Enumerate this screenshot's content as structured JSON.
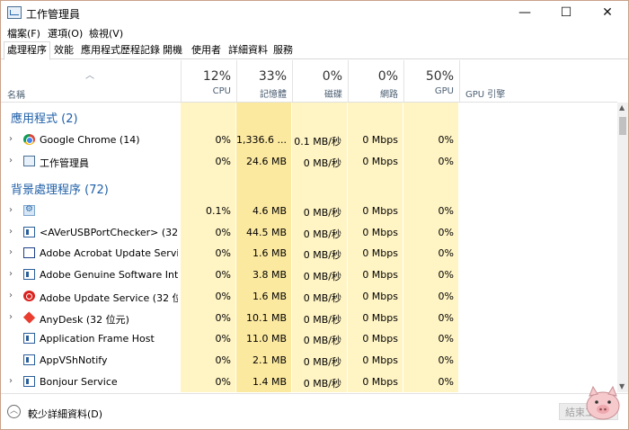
{
  "window": {
    "title": "工作管理員",
    "minimize": "—",
    "maximize": "☐",
    "close": "✕"
  },
  "menu": [
    "檔案(F)",
    "選項(O)",
    "檢視(V)"
  ],
  "tabs": [
    "處理程序",
    "效能",
    "應用程式歷程記錄",
    "開機",
    "使用者",
    "詳細資料",
    "服務"
  ],
  "active_tab": "處理程序",
  "columns": {
    "name": "名稱",
    "cpu": {
      "pct": "12%",
      "label": "CPU"
    },
    "memory": {
      "pct": "33%",
      "label": "記憶體"
    },
    "disk": {
      "pct": "0%",
      "label": "磁碟"
    },
    "network": {
      "pct": "0%",
      "label": "網路"
    },
    "gpu": {
      "pct": "50%",
      "label": "GPU"
    },
    "gpu_engine": {
      "label": "GPU 引擎"
    }
  },
  "groups": {
    "apps": "應用程式 (2)",
    "background": "背景處理程序 (72)"
  },
  "apps": [
    {
      "name": "Google Chrome (14)",
      "icon": "chrome-icon",
      "cpu": "0%",
      "mem": "1,336.6 ...",
      "disk": "0.1 MB/秒",
      "net": "0 Mbps",
      "gpu": "0%"
    },
    {
      "name": "工作管理員",
      "icon": "task-manager-icon",
      "cpu": "0%",
      "mem": "24.6 MB",
      "disk": "0 MB/秒",
      "net": "0 Mbps",
      "gpu": "0%"
    }
  ],
  "background": [
    {
      "name": "",
      "icon": "gear-icon",
      "chev": true,
      "cpu": "0.1%",
      "mem": "4.6 MB",
      "disk": "0 MB/秒",
      "net": "0 Mbps",
      "gpu": "0%"
    },
    {
      "name": "<AVerUSBPortChecker> (32 ...",
      "icon": "window-icon",
      "chev": true,
      "cpu": "0%",
      "mem": "44.5 MB",
      "disk": "0 MB/秒",
      "net": "0 Mbps",
      "gpu": "0%"
    },
    {
      "name": "Adobe Acrobat Update Servi...",
      "icon": "frame-icon",
      "chev": true,
      "cpu": "0%",
      "mem": "1.6 MB",
      "disk": "0 MB/秒",
      "net": "0 Mbps",
      "gpu": "0%"
    },
    {
      "name": "Adobe Genuine Software Inte...",
      "icon": "window-icon",
      "chev": true,
      "cpu": "0%",
      "mem": "3.8 MB",
      "disk": "0 MB/秒",
      "net": "0 Mbps",
      "gpu": "0%"
    },
    {
      "name": "Adobe Update Service (32 位...",
      "icon": "adobe-icon",
      "chev": true,
      "cpu": "0%",
      "mem": "1.6 MB",
      "disk": "0 MB/秒",
      "net": "0 Mbps",
      "gpu": "0%"
    },
    {
      "name": "AnyDesk (32 位元)",
      "icon": "anydesk-icon",
      "chev": true,
      "cpu": "0%",
      "mem": "10.1 MB",
      "disk": "0 MB/秒",
      "net": "0 Mbps",
      "gpu": "0%"
    },
    {
      "name": "Application Frame Host",
      "icon": "window-icon",
      "chev": false,
      "cpu": "0%",
      "mem": "11.0 MB",
      "disk": "0 MB/秒",
      "net": "0 Mbps",
      "gpu": "0%"
    },
    {
      "name": "AppVShNotify",
      "icon": "window-icon",
      "chev": false,
      "cpu": "0%",
      "mem": "2.1 MB",
      "disk": "0 MB/秒",
      "net": "0 Mbps",
      "gpu": "0%"
    },
    {
      "name": "Bonjour Service",
      "icon": "window-icon",
      "chev": true,
      "cpu": "0%",
      "mem": "1.4 MB",
      "disk": "0 MB/秒",
      "net": "0 Mbps",
      "gpu": "0%"
    }
  ],
  "footer": {
    "fewer_details": "較少詳細資料(D)",
    "end_task": "結束工作"
  },
  "colors": {
    "heat_light": "#fff4c4",
    "heat_medium": "#fce9a0",
    "group_text": "#1f5fa8"
  }
}
